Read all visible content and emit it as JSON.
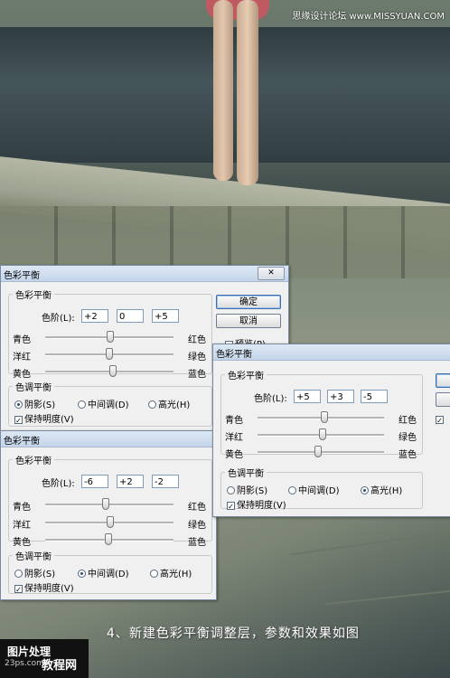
{
  "watermark_top": "思缘设计论坛 www.MISSYUAN.COM",
  "caption": "4、新建色彩平衡调整层，参数和效果如图",
  "logo": {
    "line1": "图片处理",
    "line2": "23ps.com",
    "line3": "教程网"
  },
  "labels": {
    "cyan": "青色",
    "red": "红色",
    "magenta": "洋红",
    "green": "绿色",
    "yellow": "黄色",
    "blue": "蓝色",
    "levels": "色阶(L):",
    "section_color_balance": "色彩平衡",
    "section_tone_balance": "色调平衡",
    "shadows": "阴影(S)",
    "midtones": "中间调(D)",
    "highlights": "高光(H)",
    "preserve_luminosity": "保持明度(V)",
    "ok": "确定",
    "cancel": "取消",
    "preview": "预览(P)"
  },
  "dialogs": {
    "shadows_dialog": {
      "title": "色彩平衡",
      "levels": [
        "+2",
        "0",
        "+5"
      ],
      "slider_values": [
        2,
        0,
        5
      ],
      "tone": "shadows",
      "preserve": true
    },
    "midtones_dialog": {
      "title": "色彩平衡",
      "levels": [
        "-6",
        "+2",
        "-2"
      ],
      "slider_values": [
        -6,
        2,
        -2
      ],
      "tone": "midtones",
      "preserve": true
    },
    "highlights_dialog": {
      "title": "色彩平衡",
      "levels": [
        "+5",
        "+3",
        "-5"
      ],
      "slider_values": [
        5,
        3,
        -5
      ],
      "tone": "highlights",
      "preserve": true
    }
  },
  "close_glyph": "✕",
  "check_glyph": "✓"
}
